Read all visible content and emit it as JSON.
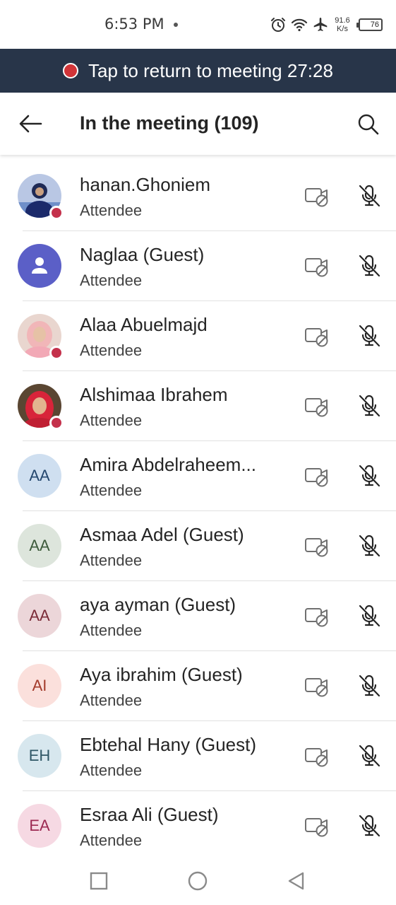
{
  "status_bar": {
    "time": "6:53 PM",
    "net_speed_value": "91.6",
    "net_speed_unit": "K/s",
    "battery": "76"
  },
  "banner": {
    "text": "Tap to return to meeting 27:28",
    "accent_color": "#d13438",
    "background": "#283549"
  },
  "header": {
    "title": "In the meeting (109)",
    "back_icon": "arrow-left-icon",
    "search_icon": "search-icon"
  },
  "participants": [
    {
      "name": "hanan.Ghoniem",
      "role": "Attendee",
      "avatar_type": "photo",
      "initials": "",
      "presence": "busy"
    },
    {
      "name": "Naglaa (Guest)",
      "role": "Attendee",
      "avatar_type": "generic",
      "initials": "",
      "presence": "none"
    },
    {
      "name": "Alaa Abuelmajd",
      "role": "Attendee",
      "avatar_type": "photo",
      "initials": "",
      "presence": "busy"
    },
    {
      "name": "Alshimaa Ibrahem",
      "role": "Attendee",
      "avatar_type": "photo",
      "initials": "",
      "presence": "busy"
    },
    {
      "name": "Amira Abdelraheem...",
      "role": "Attendee",
      "avatar_type": "initials",
      "initials": "AA",
      "presence": "none"
    },
    {
      "name": "Asmaa Adel (Guest)",
      "role": "Attendee",
      "avatar_type": "initials",
      "initials": "AA",
      "presence": "none"
    },
    {
      "name": "aya ayman (Guest)",
      "role": "Attendee",
      "avatar_type": "initials",
      "initials": "AA",
      "presence": "none"
    },
    {
      "name": "Aya ibrahim (Guest)",
      "role": "Attendee",
      "avatar_type": "initials",
      "initials": "AI",
      "presence": "none"
    },
    {
      "name": "Ebtehal Hany (Guest)",
      "role": "Attendee",
      "avatar_type": "initials",
      "initials": "EH",
      "presence": "none"
    },
    {
      "name": "Esraa Ali (Guest)",
      "role": "Attendee",
      "avatar_type": "initials",
      "initials": "EA",
      "presence": "none"
    }
  ],
  "avatar_colors": {
    "generic_bg": "#5b5fc7",
    "aa_blue_bg": "#cfdff0",
    "aa_blue_fg": "#24476e",
    "aa_green_bg": "#dde5dc",
    "aa_green_fg": "#3d5a3b",
    "aa_rose_bg": "#ecd6d9",
    "aa_rose_fg": "#7a2b37",
    "ai_bg": "#fbe0dc",
    "ai_fg": "#a33b2c",
    "eh_bg": "#d7e7ee",
    "eh_fg": "#2f5766",
    "ea_bg": "#f6d9e3",
    "ea_fg": "#9c2a52"
  },
  "row_icons": {
    "camera": "video-off-icon",
    "mic": "mic-off-icon"
  },
  "nav_bar": {
    "recents": "square-icon",
    "home": "circle-icon",
    "back": "triangle-back-icon"
  }
}
